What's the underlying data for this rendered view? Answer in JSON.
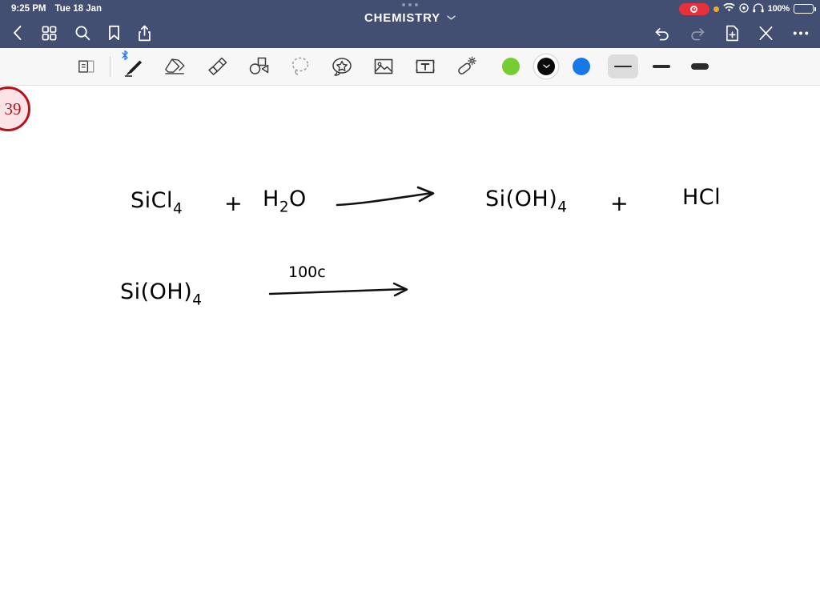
{
  "status_bar": {
    "time": "9:25 PM",
    "date": "Tue 18 Jan",
    "battery_percent": "100%",
    "icons": {
      "recording": "screen-recording-indicator",
      "orange_dot": "microphone-in-use-dot",
      "wifi": "wifi-icon",
      "location": "location-icon",
      "headphones": "headphones-icon",
      "battery": "battery-icon"
    }
  },
  "nav_bar": {
    "title": "CHEMISTRY",
    "left_items": [
      {
        "name": "back-button",
        "icon": "chevron-left-icon"
      },
      {
        "name": "thumbnails-button",
        "icon": "grid-icon"
      },
      {
        "name": "search-button",
        "icon": "search-icon"
      },
      {
        "name": "bookmark-button",
        "icon": "bookmark-icon"
      },
      {
        "name": "share-button",
        "icon": "share-icon"
      }
    ],
    "right_items": [
      {
        "name": "undo-button",
        "icon": "undo-icon",
        "enabled": true
      },
      {
        "name": "redo-button",
        "icon": "redo-icon",
        "enabled": false
      },
      {
        "name": "add-page-button",
        "icon": "document-plus-icon"
      },
      {
        "name": "close-button",
        "icon": "close-icon"
      },
      {
        "name": "more-button",
        "icon": "ellipsis-icon"
      }
    ],
    "title_chevron": "chevron-down-icon",
    "drag_handle": "three-dots-handle"
  },
  "toolbar": {
    "tools": [
      {
        "name": "page-flip-tool",
        "icon": "page-flip-icon",
        "selected": false
      },
      {
        "name": "pen-tool",
        "icon": "pen-icon",
        "selected": true,
        "badge": "bluetooth-icon"
      },
      {
        "name": "eraser-tool",
        "icon": "eraser-icon",
        "selected": false
      },
      {
        "name": "highlighter-tool",
        "icon": "highlighter-icon",
        "selected": false
      },
      {
        "name": "shapes-tool",
        "icon": "shapes-icon",
        "selected": false
      },
      {
        "name": "lasso-tool",
        "icon": "lasso-icon",
        "selected": false
      },
      {
        "name": "sticker-tool",
        "icon": "sticker-star-icon",
        "selected": false
      },
      {
        "name": "image-tool",
        "icon": "image-icon",
        "selected": false
      },
      {
        "name": "text-tool",
        "icon": "text-box-icon",
        "selected": false
      },
      {
        "name": "magic-tool",
        "icon": "magic-wand-icon",
        "selected": false
      }
    ],
    "colors": [
      {
        "name": "color-swatch-green",
        "hex": "#76CC33",
        "selected": false
      },
      {
        "name": "color-swatch-black",
        "hex": "#0A0A0A",
        "selected": true
      },
      {
        "name": "color-swatch-blue",
        "hex": "#1878E8",
        "selected": false
      }
    ],
    "stroke_widths": [
      {
        "name": "stroke-width-thin",
        "selected": true
      },
      {
        "name": "stroke-width-medium",
        "selected": false
      },
      {
        "name": "stroke-width-thick",
        "selected": false
      }
    ]
  },
  "canvas": {
    "page_number": "39",
    "equations": [
      {
        "id": "reaction-1",
        "reactant_1": "SiCl",
        "reactant_1_sub": "4",
        "plus_1": "+",
        "reactant_2_a": "H",
        "reactant_2_sub": "2",
        "reactant_2_b": "O",
        "arrow": "reaction-arrow",
        "product_1": "Si(OH)",
        "product_1_sub": "4",
        "plus_2": "+",
        "product_2": "HCl"
      },
      {
        "id": "reaction-2",
        "reactant_1": "Si(OH)",
        "reactant_1_sub": "4",
        "arrow_label": "100c",
        "arrow": "reaction-arrow"
      }
    ]
  }
}
